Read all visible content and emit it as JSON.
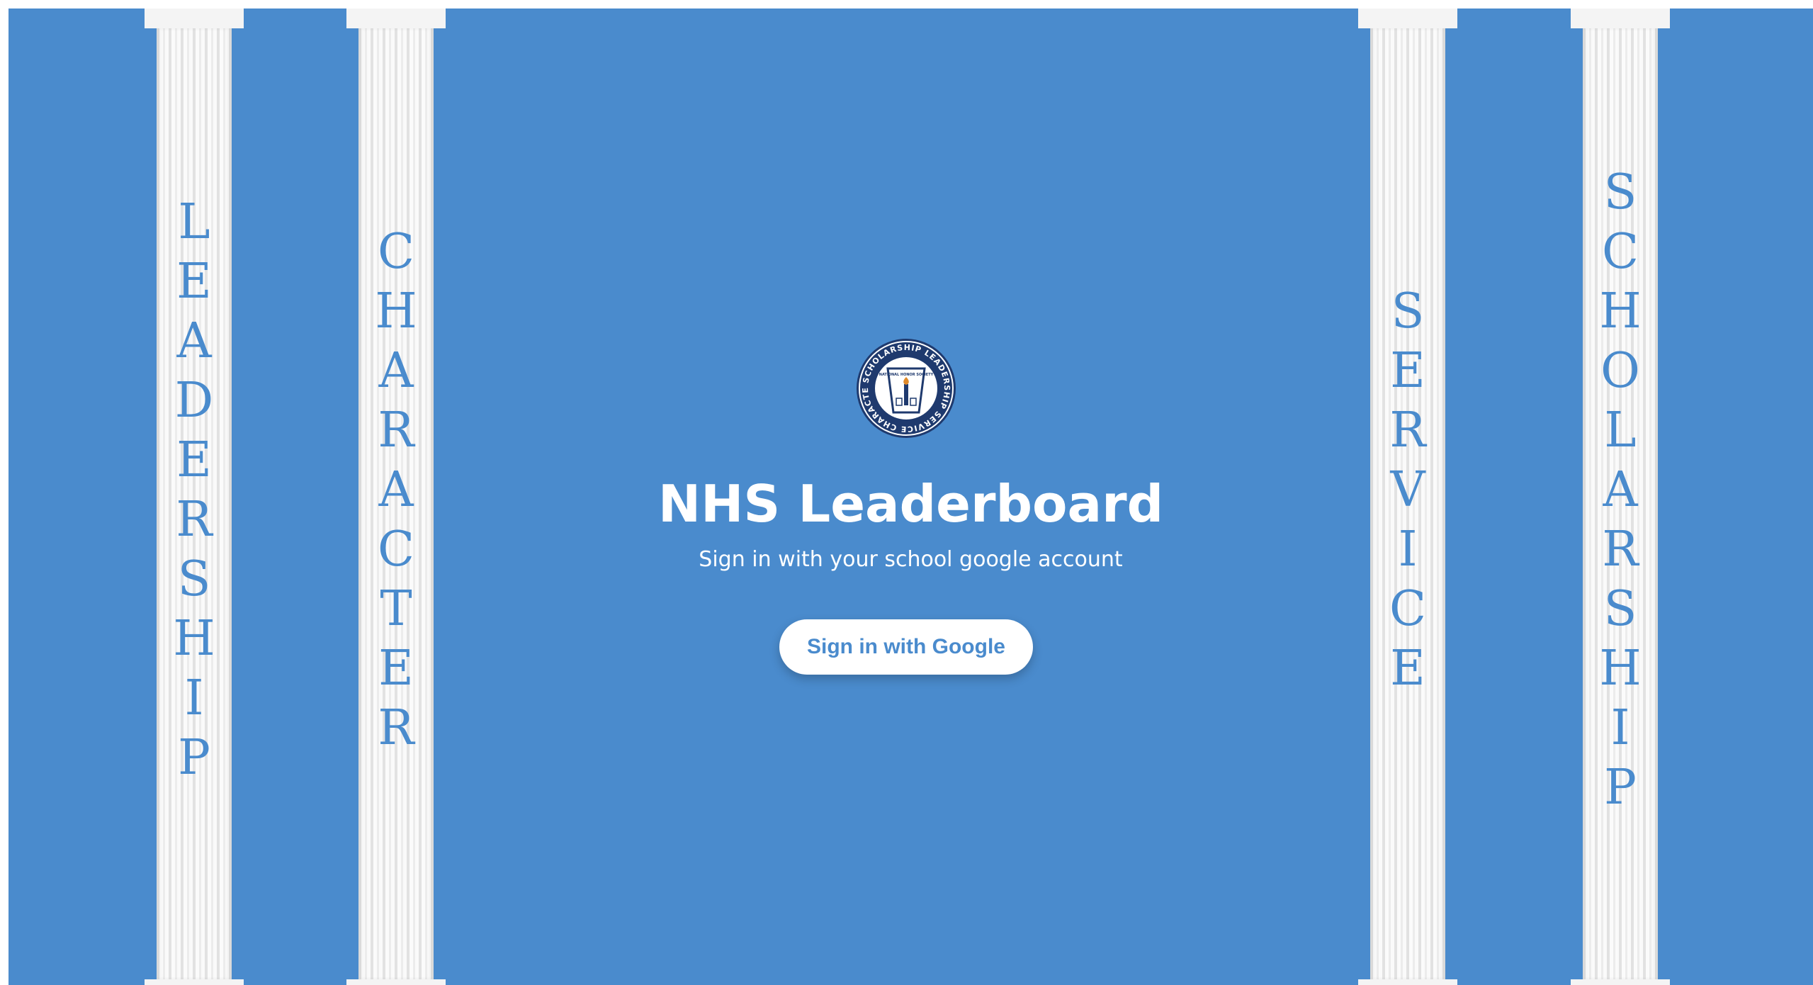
{
  "pillars": [
    {
      "word": "LEADERSHIP"
    },
    {
      "word": "CHARACTER"
    },
    {
      "word": "SERVICE"
    },
    {
      "word": "SCHOLARSHIP"
    }
  ],
  "logo": {
    "ring_text": "SCHOLARSHIP LEADERSHIP SERVICE CHARACTER",
    "inner_text": "NATIONAL HONOR SOCIETY"
  },
  "title": "NHS Leaderboard",
  "subtitle": "Sign in with your school google account",
  "signin_button": "Sign in with Google",
  "colors": {
    "background": "#4a8bcd",
    "pillar": "#f4f4f4",
    "logo_navy": "#1f3a6e"
  }
}
